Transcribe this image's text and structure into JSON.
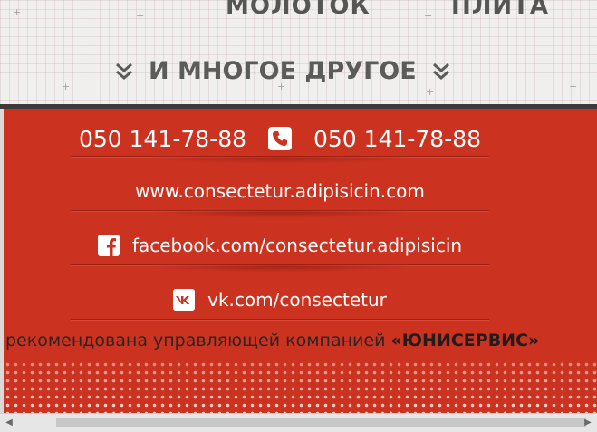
{
  "top_section": {
    "items": [
      "МОЛОТОК",
      "ПЛИТА"
    ],
    "more_label": "И МНОГОЕ ДРУГОЕ"
  },
  "contacts": {
    "phone_left": "050 141-78-88",
    "phone_right": "050 141-78-88",
    "website": "www.consectetur.adipisicin.com",
    "facebook": "facebook.com/consectetur.adipisicin",
    "vk": "vk.com/consectetur"
  },
  "footer": {
    "text": "рекомендована управляющей компанией ",
    "company": "«ЮНИСЕРВИС»"
  },
  "colors": {
    "accent_red": "#cc3220",
    "light_bg": "#f1eeee",
    "dark_line": "#3e3a39"
  },
  "icons": {
    "phone": "phone-icon",
    "facebook": "facebook-icon",
    "vk": "vk-icon",
    "chevron": "double-chevron-down-icon"
  }
}
